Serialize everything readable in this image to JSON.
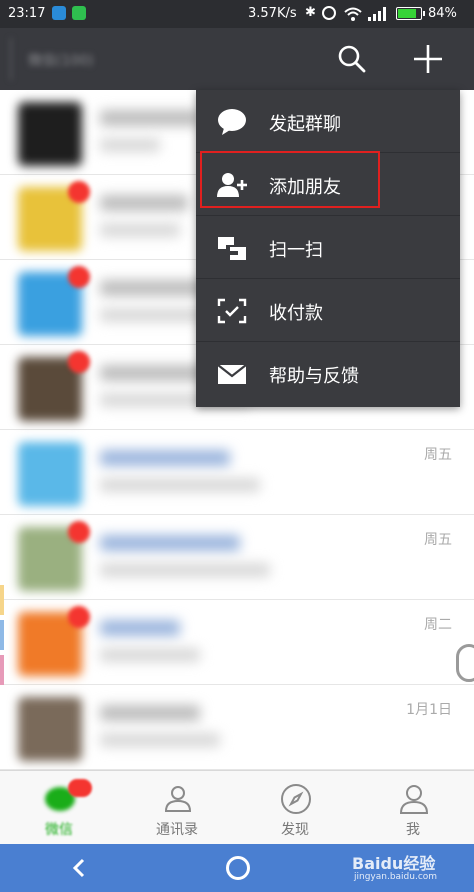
{
  "status_bar": {
    "time": "23:17",
    "network_speed": "3.57K/s",
    "battery_level": 0.84,
    "battery_text": "84%",
    "icons": [
      "app-notification-icon",
      "wechat-notification-icon",
      "bluetooth-icon",
      "alarm-icon",
      "wifi-icon",
      "signal-icon",
      "battery-icon"
    ]
  },
  "header": {
    "account_name": "微信(100)",
    "search_icon": "search-icon",
    "add_icon": "plus-icon"
  },
  "menu": {
    "items": [
      {
        "label": "发起群聊",
        "icon": "chat-bubble-icon"
      },
      {
        "label": "添加朋友",
        "icon": "add-friend-icon"
      },
      {
        "label": "扫一扫",
        "icon": "scan-icon"
      },
      {
        "label": "收付款",
        "icon": "payment-icon"
      },
      {
        "label": "帮助与反馈",
        "icon": "envelope-icon"
      }
    ]
  },
  "chats": [
    {
      "time": "",
      "avatar_color": "#1e1e1e"
    },
    {
      "time": "",
      "avatar_color": "#e8c23a"
    },
    {
      "time": "",
      "avatar_color": "#3aa0e0"
    },
    {
      "time": "",
      "avatar_color": "#5a4a3a"
    },
    {
      "time": "周五",
      "avatar_color": "#5ab8e8"
    },
    {
      "time": "周五",
      "avatar_color": "#9ab080"
    },
    {
      "time": "周二",
      "avatar_color": "#f07a28"
    },
    {
      "time": "1月1日",
      "avatar_color": "#7a6a5a"
    }
  ],
  "tabs": [
    {
      "label": "微信",
      "icon": "chats-icon"
    },
    {
      "label": "通讯录",
      "icon": "contacts-icon"
    },
    {
      "label": "发现",
      "icon": "discover-compass-icon"
    },
    {
      "label": "我",
      "icon": "me-person-icon"
    }
  ],
  "nav": {
    "back_icon": "back-icon",
    "home_icon": "home-icon"
  },
  "watermark": {
    "text": "Baidu经验",
    "sub": "jingyan.baidu.com"
  },
  "colors": {
    "status_bar": "#2c2d31",
    "action_bar": "#393a3f",
    "menu_bg": "#3a3b3f",
    "highlight": "#e0201f",
    "wechat_green": "#1aad19",
    "badge_red": "#f43530",
    "nav_bar": "#4a7fd1"
  }
}
